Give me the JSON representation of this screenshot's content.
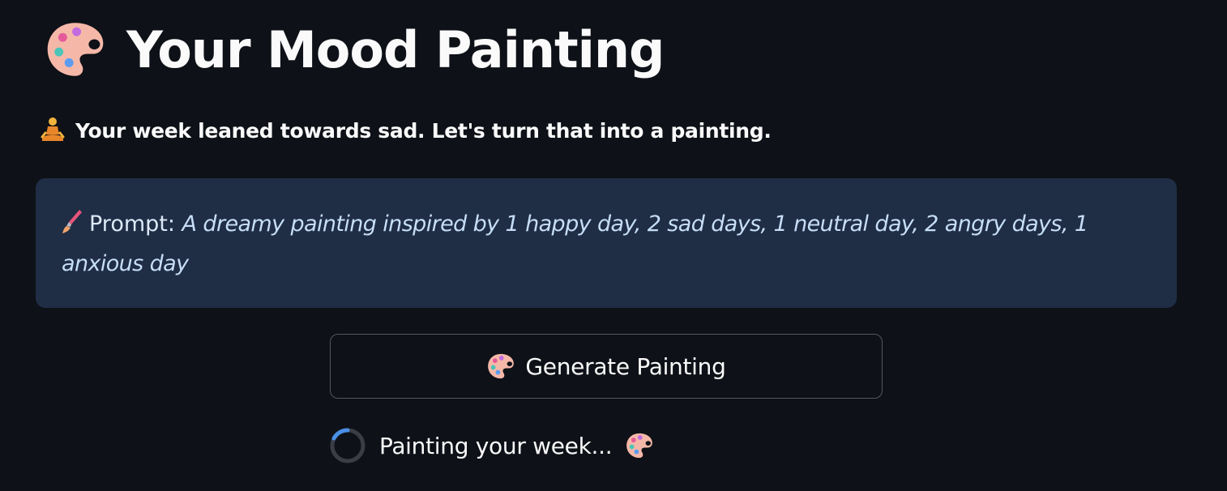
{
  "header": {
    "title": "Your Mood Painting",
    "icon": "palette-icon"
  },
  "summary": {
    "icon": "meditating-person-icon",
    "text": "Your week leaned towards sad. Let's turn that into a painting."
  },
  "prompt": {
    "icon": "paintbrush-icon",
    "label": "Prompt: ",
    "value": "A dreamy painting inspired by 1 happy day, 2 sad days, 1 neutral day, 2 angry days, 1 anxious day"
  },
  "generate_button": {
    "icon": "palette-icon",
    "label": "Generate Painting"
  },
  "status": {
    "text": "Painting your week...",
    "icon": "palette-icon"
  },
  "colors": {
    "background": "#0e1117",
    "prompt_box": "#1f2d45",
    "prompt_text": "#c7def7",
    "spinner_accent": "#4a8fe7"
  }
}
